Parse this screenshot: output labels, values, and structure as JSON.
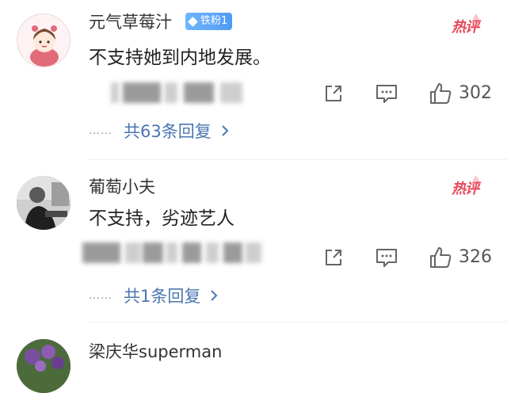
{
  "comments": [
    {
      "username": "元气草莓汁",
      "badge": "铁粉1",
      "hot_tag": "热评",
      "text": "不支持她到内地发展。",
      "likes": "302",
      "replies_dots": "……",
      "replies_label": "共63条回复"
    },
    {
      "username": "葡萄小夫",
      "hot_tag": "热评",
      "text": "不支持，劣迹艺人",
      "likes": "326",
      "replies_dots": "……",
      "replies_label": "共1条回复"
    },
    {
      "username": "梁庆华superman"
    }
  ],
  "icons": {
    "share": "share-icon",
    "comment": "comment-icon",
    "like": "thumbs-up-icon",
    "chevron": "chevron-right-icon",
    "diamond": "diamond-icon"
  },
  "colors": {
    "hot_tag": "#e8475a",
    "badge": "#4f9bf2",
    "reply_link": "#4a76b0"
  }
}
